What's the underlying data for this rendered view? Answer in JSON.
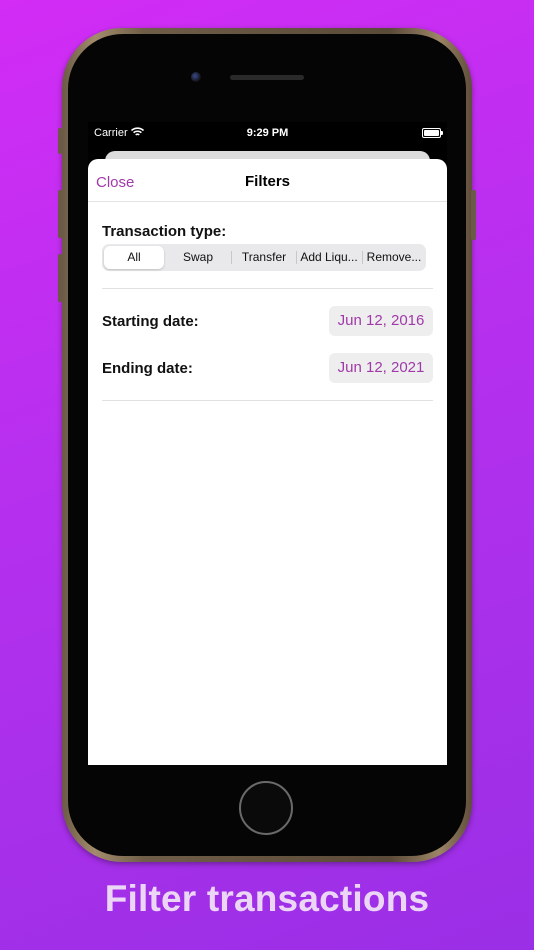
{
  "status_bar": {
    "carrier": "Carrier",
    "time": "9:29 PM"
  },
  "sheet": {
    "close_label": "Close",
    "title": "Filters"
  },
  "transaction_type": {
    "label": "Transaction type:",
    "options": [
      "All",
      "Swap",
      "Transfer",
      "Add Liqu...",
      "Remove..."
    ],
    "selected": "All"
  },
  "dates": {
    "start_label": "Starting date:",
    "start_value": "Jun 12, 2016",
    "end_label": "Ending date:",
    "end_value": "Jun 12, 2021"
  },
  "caption": "Filter transactions",
  "colors": {
    "accent": "#a03aa8",
    "background_start": "#d22cf5",
    "background_end": "#9a2fe6"
  }
}
